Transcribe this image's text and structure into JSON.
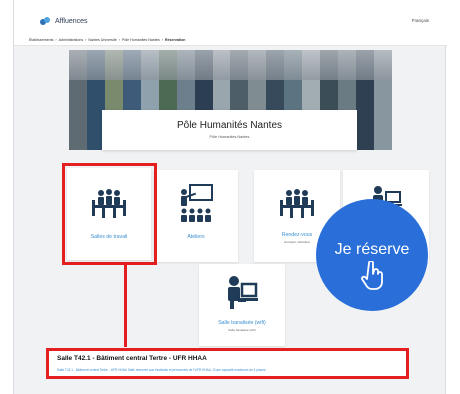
{
  "app": {
    "brand": "Affluences",
    "language": "Français"
  },
  "breadcrumb": [
    "Établissements",
    "Administrations",
    "Nantes Université",
    "Pôle Humanités Nantes",
    "Réservation"
  ],
  "place": {
    "title": "Pôle Humanités Nantes",
    "subtitle": "Pôle Humanités Nantes"
  },
  "categories": [
    {
      "label": "Salles de travail",
      "sub": "",
      "icon": "meeting-table-icon"
    },
    {
      "label": "Ateliers",
      "sub": "",
      "icon": "presentation-board-icon"
    },
    {
      "label": "Rendez-vous",
      "sub": "Entretien individuel",
      "icon": "meeting-table-icon"
    },
    {
      "label": "",
      "sub": "",
      "icon": "computer-user-icon"
    },
    {
      "label": "Salle banalisée (wifi)",
      "sub": "Salle banalisée (wifi)",
      "icon": "computer-user-icon"
    }
  ],
  "cta": {
    "label": "Je réserve",
    "icon": "hand-pointer-icon"
  },
  "result": {
    "title": "Salle T42.1 - Bâtiment central Tertre - UFR HHAA",
    "description": "Salle T42.1 - Bâtiment central Tertre - UFR HHAA Salle réservée aux étudiants et personnels de l'UFR HHAA. D'une capacité maximum de 4 places"
  },
  "colors": {
    "highlight": "#e3201f",
    "cta": "#2a6fd9",
    "link": "#3a8fd0"
  }
}
